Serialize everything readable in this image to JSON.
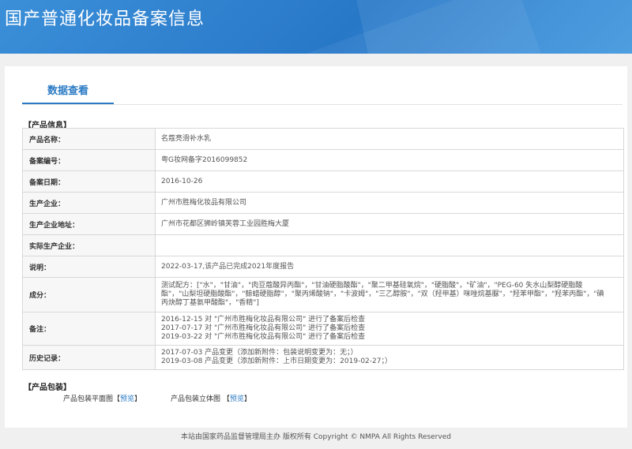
{
  "header": {
    "title": "国产普通化妆品备案信息"
  },
  "tab": {
    "label": "数据查看"
  },
  "product_info": {
    "section_title": "【产品信息】",
    "rows": [
      {
        "label": "产品名称：",
        "value": "名蔻亮滑补水乳"
      },
      {
        "label": "备案编号：",
        "value": "粤G妆网备字2016099852"
      },
      {
        "label": "备案日期：",
        "value": "2016-10-26"
      },
      {
        "label": "生产企业：",
        "value": "广州市胜梅化妆品有限公司"
      },
      {
        "label": "生产企业地址：",
        "value": "广州市花都区狮岭镇芙蓉工业园胜梅大厦"
      },
      {
        "label": "实际生产企业：",
        "value": ""
      },
      {
        "label": "说明：",
        "value": "2022-03-17,该产品已完成2021年度报告"
      },
      {
        "label": "成分：",
        "value": "测试配方：[\"水\"，\"甘油\"，\"肉豆蔻酸异丙酯\"，\"甘油硬脂酸酯\"，\"聚二甲基硅氧烷\"，\"硬脂酸\"，\"矿油\"，\"PEG-60 失水山梨醇硬脂酸酯\"，\"山梨坦硬脂酸酯\"，\"鲸蜡硬脂醇\"，\"聚丙烯酸钠\"，\"卡波姆\"，\"三乙醇胺\"，\"双（羟甲基）咪唑烷基脲\"，\"羟苯甲酯\"，\"羟苯丙酯\"，\"碘丙炔醇丁基氨甲酸酯\"，\"香精\"]"
      },
      {
        "label": "备注：",
        "lines": [
          "2016-12-15 对 \"广州市胜梅化妆品有限公司\" 进行了备案后检查",
          "2017-07-17 对 \"广州市胜梅化妆品有限公司\" 进行了备案后检查",
          "2019-03-22 对 \"广州市胜梅化妆品有限公司\" 进行了备案后检查"
        ]
      },
      {
        "label": "历史记录：",
        "lines": [
          "2017-07-03 产品变更（添加新附件：包装说明变更为：无；）",
          "2019-03-08 产品变更（添加新附件：上市日期变更为：2019-02-27；）"
        ]
      }
    ]
  },
  "packaging": {
    "section_title": "【产品包装】",
    "flat_label": "产品包装平面图",
    "stereo_label": "产品包装立体图",
    "bracket_open": "【",
    "bracket_close": "】",
    "preview_label": "预览"
  },
  "footer": {
    "text": "本站由国家药品监督管理局主办 版权所有 Copyright © NMPA All Rights Reserved"
  },
  "colors": {
    "accent": "#2b7bc4",
    "header_bg": "#2f83d0",
    "table_border": "#7fb7de"
  }
}
